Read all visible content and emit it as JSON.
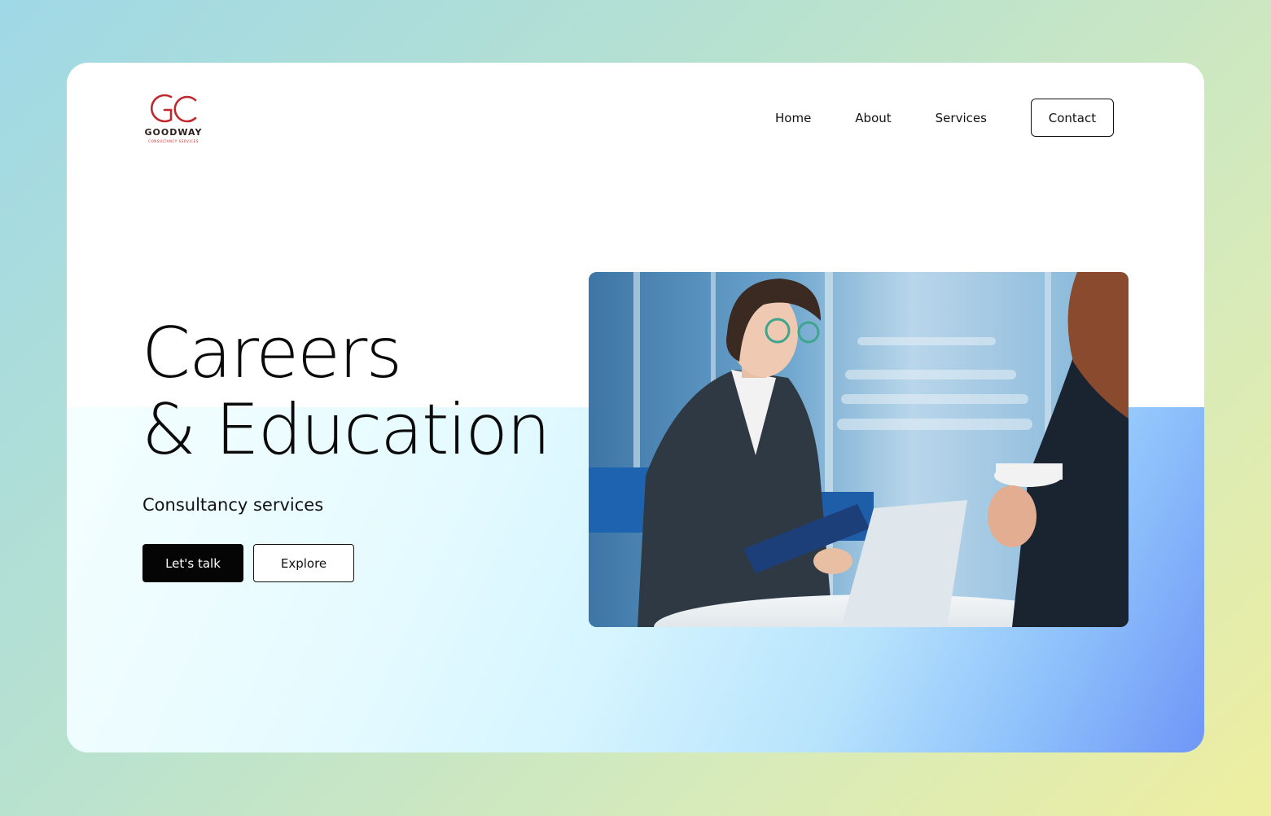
{
  "brand": {
    "name": "GOODWAY",
    "tagline": "CONSULTANCY SERVICES",
    "monogram": "GC",
    "color": "#c0282d"
  },
  "nav": {
    "items": [
      {
        "label": "Home"
      },
      {
        "label": "About"
      },
      {
        "label": "Services"
      }
    ],
    "contact_label": "Contact"
  },
  "hero": {
    "title_line1": "Careers",
    "title_line2": "& Education",
    "subtitle": "Consultancy services",
    "primary_button": "Let's talk",
    "secondary_button": "Explore"
  },
  "image": {
    "description_icon": "business-meeting-photo"
  },
  "colors": {
    "primary_button_bg": "#050505",
    "logo_red": "#c0282d"
  }
}
